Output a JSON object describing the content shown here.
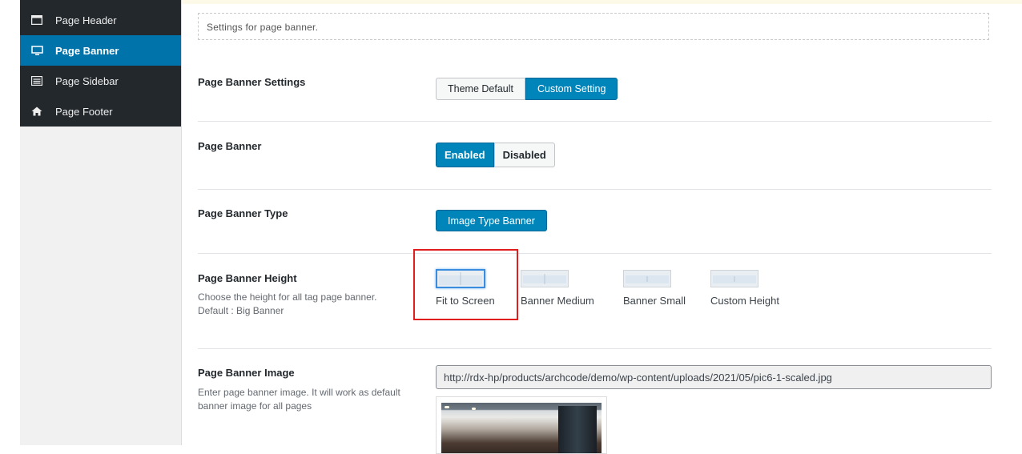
{
  "sidebar": {
    "items": [
      {
        "label": "Page Header",
        "icon": "header-window-icon",
        "active": false
      },
      {
        "label": "Page Banner",
        "icon": "monitor-icon",
        "active": true
      },
      {
        "label": "Page Sidebar",
        "icon": "sidebar-list-icon",
        "active": false
      },
      {
        "label": "Page Footer",
        "icon": "home-icon",
        "active": false
      }
    ]
  },
  "section_description": "Settings for page banner.",
  "rows": {
    "banner_settings": {
      "title": "Page Banner Settings",
      "options": [
        "Theme Default",
        "Custom Setting"
      ],
      "selected": "Custom Setting"
    },
    "banner_toggle": {
      "title": "Page Banner",
      "options": [
        "Enabled",
        "Disabled"
      ],
      "selected": "Enabled"
    },
    "banner_type": {
      "title": "Page Banner Type",
      "button": "Image Type Banner"
    },
    "banner_height": {
      "title": "Page Banner Height",
      "description_line1": "Choose the height for all tag page banner.",
      "description_line2": "Default : Big Banner",
      "options": [
        "Fit to Screen",
        "Banner Medium",
        "Banner Small",
        "Custom Height"
      ],
      "selected": "Fit to Screen"
    },
    "banner_image": {
      "title": "Page Banner Image",
      "description": "Enter page banner image. It will work as default banner image for all pages",
      "url": "http://rdx-hp/products/archcode/demo/wp-content/uploads/2021/05/pic6-1-scaled.jpg"
    }
  },
  "colors": {
    "accent": "#0085ba",
    "sidebar_bg": "#23282d",
    "active_nav": "#0073aa",
    "highlight_box": "#e01e1e"
  }
}
